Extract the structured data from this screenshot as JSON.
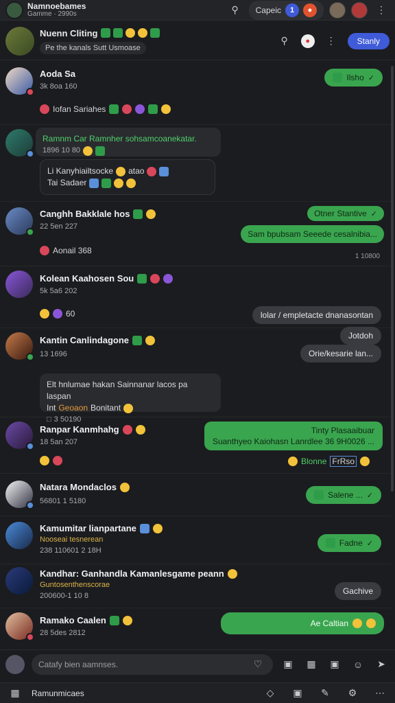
{
  "topbar": {
    "title": "Namnoebames",
    "subtitle": "Gamme · 2990s",
    "pill_label": "Capeic",
    "pill_count": "1",
    "colors": {
      "accent": "#3f5bd8"
    }
  },
  "chat": {
    "name": "Nuenn Cliting",
    "sub": "Pe the kanals Sutt Usmoase",
    "status_button": "Stanly"
  },
  "rows": [
    {
      "name": "Aoda Sa",
      "meta": "3k 8oa 160",
      "note": "Iofan Sariahes",
      "reply": "Ilsho"
    },
    {
      "name": "",
      "meta": "1896 10 80",
      "quote": "Ramnm Car Ramnher sohsamcoanekatar.",
      "card_line1": "Li Kanyhiailtsocke",
      "card_line1b": "atao",
      "card_line2": "Tai Sadaer"
    },
    {
      "name": "Canghh Bakklale hos",
      "meta": "22 5en 227",
      "note": "Aonail 368",
      "reply_top": "Otner Stantive",
      "reply_bottom": "Sam bpubsam  Seeede cesalnibia...",
      "time": "1 10800"
    },
    {
      "name": "Kolean Kaahosen Sou",
      "meta": "5k 5a6 202",
      "note": "60",
      "reply": "lolar / empletacte dnanasontan"
    },
    {
      "name": "Kantin Canlindagone",
      "meta": "13 1696",
      "reply_top": "Jotdoh",
      "reply_bottom": "Orie/kesarie lan...",
      "card_line1": "Elt hnlumae hakan Sainnanar lacos pa laspan",
      "card_line2a": "Int",
      "card_line2b": "Geoaon",
      "card_line2c": "Bonitant",
      "card_line3": "3 50190"
    },
    {
      "name": "Ranpar Kanmhahg",
      "meta": "18 5an 207",
      "reply_top": "Tinty Plasaaibuar",
      "reply_bottom": "Suanthyeo Kaiohasn Lanrdlee 36 9H0026 ...",
      "reply_footer_a": "Blonne",
      "reply_footer_b": "FrRso"
    },
    {
      "name": "Natara Mondaclos",
      "meta": "56801 1 5180",
      "reply": "Salene ..."
    },
    {
      "name": "Kamumitar lianpartane",
      "meta_green": "Nooseai tesnerean",
      "meta": "238 110601 2 18H",
      "reply": "Fadne"
    },
    {
      "name": "Kandhar: Ganhandla Kamanlesgame peann",
      "meta_green": "Guntosenthenscorae",
      "meta": "200600-1 10 8",
      "reply": "Gachive"
    },
    {
      "name": "Ramako Caalen",
      "meta": "28 5des 2812",
      "reply": "Ae Caltian"
    }
  ],
  "composer": {
    "placeholder": "Catafy bien aamnses."
  },
  "bottombar": {
    "label": "Ramunmicaes"
  },
  "icons": [
    "search-icon",
    "bell-icon",
    "send-icon",
    "smile-icon",
    "grid-icon"
  ]
}
